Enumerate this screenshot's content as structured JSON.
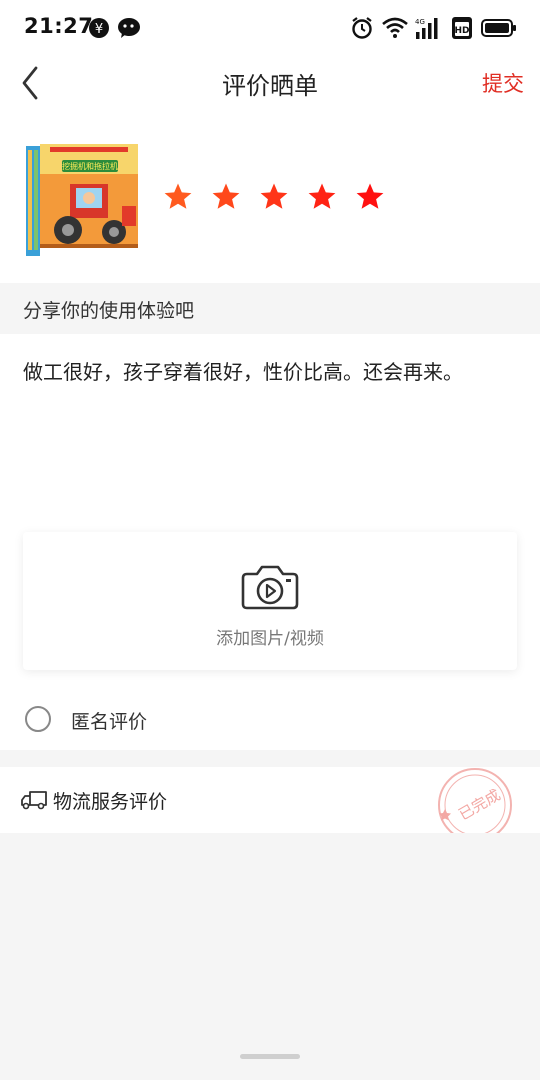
{
  "status_bar": {
    "time": "21:27",
    "network_label": "4G"
  },
  "nav": {
    "title": "评价晒单",
    "submit_label": "提交"
  },
  "product": {
    "rating": 5,
    "max_rating": 5,
    "book_title": "挖掘机和拖拉机"
  },
  "review": {
    "section_title": "分享你的使用体验吧",
    "text": "做工很好，孩子穿着很好，性价比高。还会再来。",
    "upload_label": "添加图片/视频",
    "anonymous_label": "匿名评价"
  },
  "logistics": {
    "label": "物流服务评价",
    "stamp_text": "已完成"
  },
  "colors": {
    "accent": "#e02e24",
    "star_start": "#ff5a1f",
    "star_end": "#ff1010"
  }
}
